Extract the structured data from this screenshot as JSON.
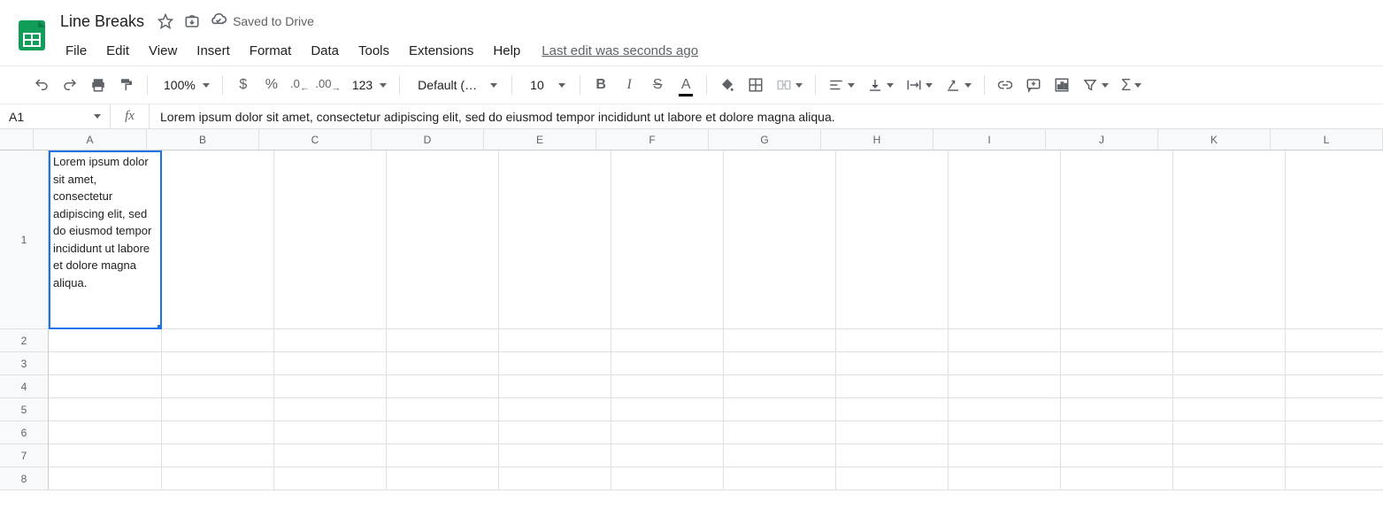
{
  "doc_title": "Line Breaks",
  "save_status": "Saved to Drive",
  "last_edit_text": "Last edit was seconds ago",
  "menus": [
    "File",
    "Edit",
    "View",
    "Insert",
    "Format",
    "Data",
    "Tools",
    "Extensions",
    "Help"
  ],
  "toolbar": {
    "zoom": "100%",
    "number_format_123": "123",
    "font": "Default (Ari...",
    "font_size": "10"
  },
  "name_box": "A1",
  "fx_label": "fx",
  "formula_text": "Lorem ipsum dolor sit amet, consectetur adipiscing elit, sed do eiusmod tempor incididunt ut labore et dolore magna aliqua.",
  "columns": [
    "A",
    "B",
    "C",
    "D",
    "E",
    "F",
    "G",
    "H",
    "I",
    "J",
    "K",
    "L"
  ],
  "rows": [
    "1",
    "2",
    "3",
    "4",
    "5",
    "6",
    "7",
    "8"
  ],
  "cells": {
    "A1": "Lorem ipsum dolor sit amet, consectetur adipiscing elit, sed do eiusmod tempor incididunt ut labore et dolore magna aliqua."
  },
  "selected_cell": "A1"
}
